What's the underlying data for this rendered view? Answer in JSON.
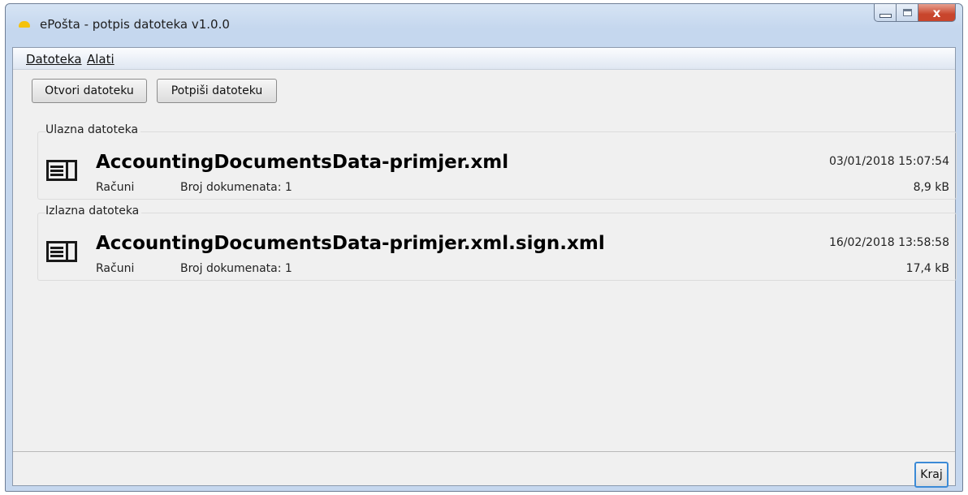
{
  "window": {
    "title": "ePošta - potpis datoteka v1.0.0",
    "controls": {
      "minimize": "",
      "maximize": "",
      "close": "x"
    }
  },
  "menu": [
    {
      "label": "Datoteka"
    },
    {
      "label": "Alati"
    }
  ],
  "toolbar": {
    "open_label": "Otvori datoteku",
    "sign_label": "Potpiši datoteku"
  },
  "input_file": {
    "group_label": "Ulazna datoteka",
    "icon": "document-list-icon",
    "filename": "AccountingDocumentsData-primjer.xml",
    "type": "Računi",
    "count": "Broj dokumenata: 1",
    "date": "03/01/2018 15:07:54",
    "size": "8,9 kB"
  },
  "output_file": {
    "group_label": "Izlazna datoteka",
    "icon": "document-list-icon",
    "filename": "AccountingDocumentsData-primjer.xml.sign.xml",
    "type": "Računi",
    "count": "Broj dokumenata: 1",
    "date": "16/02/2018 13:58:58",
    "size": "17,4 kB"
  },
  "footer": {
    "close_label": "Kraj"
  },
  "colors": {
    "accent_border": "#3b8ad6",
    "close_button": "#c8452c",
    "app_icon": "#f4c20d"
  }
}
